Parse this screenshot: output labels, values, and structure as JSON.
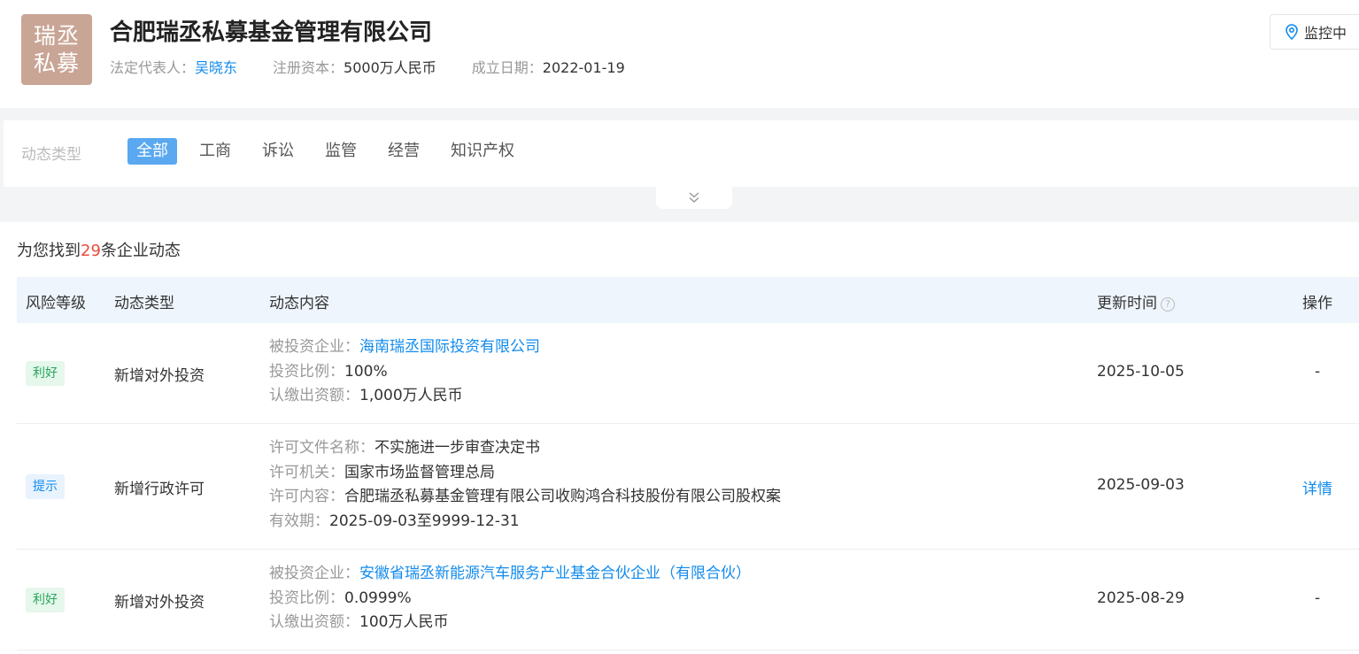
{
  "company": {
    "logo_line1": "瑞丞",
    "logo_line2": "私募",
    "name": "合肥瑞丞私募基金管理有限公司",
    "legal_rep_label": "法定代表人：",
    "legal_rep": "吴晓东",
    "capital_label": "注册资本：",
    "capital": "5000万人民币",
    "founded_label": "成立日期：",
    "founded": "2022-01-19",
    "monitor_label": "监控中"
  },
  "filter": {
    "label": "动态类型",
    "tabs": [
      "全部",
      "工商",
      "诉讼",
      "监管",
      "经营",
      "知识产权"
    ],
    "active": "全部"
  },
  "result": {
    "prefix": "为您找到",
    "count": "29",
    "suffix": "条企业动态"
  },
  "table": {
    "headers": {
      "risk": "风险等级",
      "type": "动态类型",
      "content": "动态内容",
      "time": "更新时间",
      "help": "?",
      "op": "操作"
    },
    "rows": [
      {
        "risk": "利好",
        "type": "新增对外投资",
        "lines": [
          {
            "k": "被投资企业：",
            "v": "海南瑞丞国际投资有限公司",
            "link": true
          },
          {
            "k": "投资比例：",
            "v": "100%"
          },
          {
            "k": "认缴出资额：",
            "v": "1,000万人民币"
          }
        ],
        "time": "2025-10-05",
        "op": "-"
      },
      {
        "risk": "提示",
        "type": "新增行政许可",
        "lines": [
          {
            "k": "许可文件名称：",
            "v": "不实施进一步审查决定书"
          },
          {
            "k": "许可机关：",
            "v": "国家市场监督管理总局"
          },
          {
            "k": "许可内容：",
            "v": "合肥瑞丞私募基金管理有限公司收购鸿合科技股份有限公司股权案"
          },
          {
            "k": "有效期：",
            "v": "2025-09-03至9999-12-31"
          }
        ],
        "time": "2025-09-03",
        "op": "详情"
      },
      {
        "risk": "利好",
        "type": "新增对外投资",
        "lines": [
          {
            "k": "被投资企业：",
            "v": "安徽省瑞丞新能源汽车服务产业基金合伙企业（有限合伙）",
            "link": true
          },
          {
            "k": "投资比例：",
            "v": "0.0999%"
          },
          {
            "k": "认缴出资额：",
            "v": "100万人民币"
          }
        ],
        "time": "2025-08-29",
        "op": "-"
      }
    ]
  }
}
